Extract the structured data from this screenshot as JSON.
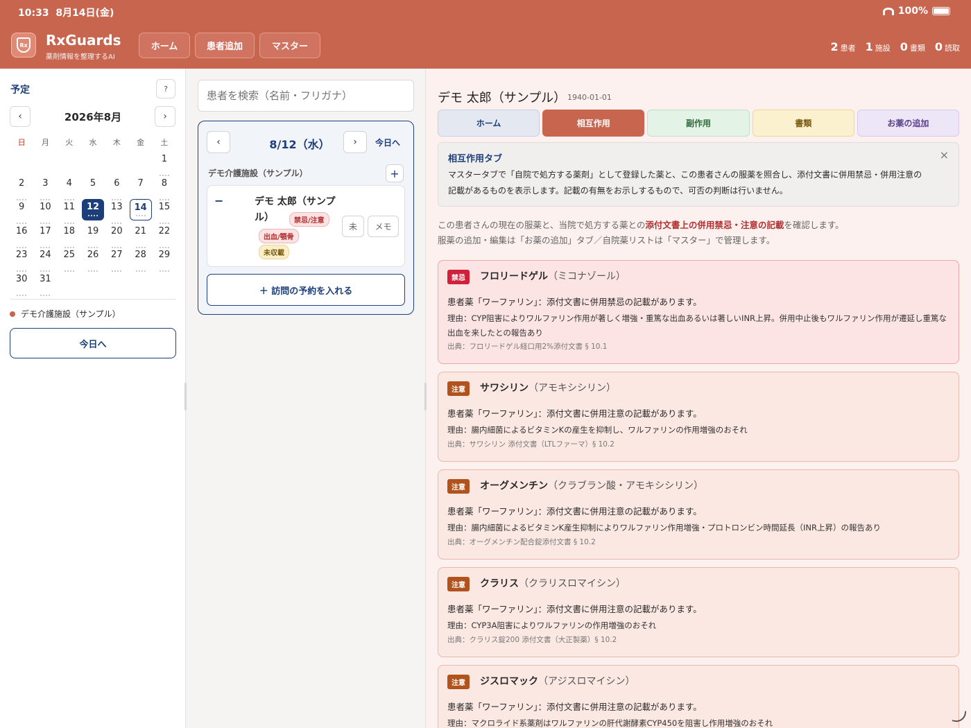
{
  "status": {
    "time": "10:33",
    "date": "8月14日(金)",
    "battery": "100%"
  },
  "header": {
    "logo_text": "Rx",
    "brand": "RxGuards",
    "tagline": "薬剤情報を整理するAI",
    "nav": [
      "ホーム",
      "患者追加",
      "マスター"
    ],
    "stats": [
      {
        "num": "2",
        "label": "患者"
      },
      {
        "num": "1",
        "label": "施設"
      },
      {
        "num": "0",
        "label": "書類"
      },
      {
        "num": "0",
        "label": "読取"
      }
    ]
  },
  "calendar": {
    "title": "予定",
    "help": "?",
    "prev": "‹",
    "next": "›",
    "month": "2026年8月",
    "dow": [
      "日",
      "月",
      "火",
      "水",
      "木",
      "金",
      "土"
    ],
    "days": [
      "",
      "",
      "",
      "",
      "",
      "",
      "1",
      "2",
      "3",
      "4",
      "5",
      "6",
      "7",
      "8",
      "9",
      "10",
      "11",
      "12",
      "13",
      "14",
      "15",
      "16",
      "17",
      "18",
      "19",
      "20",
      "21",
      "22",
      "23",
      "24",
      "25",
      "26",
      "27",
      "28",
      "29",
      "30",
      "31"
    ],
    "selected": "12",
    "today": "14",
    "facility": "デモ介護施設（サンプル）",
    "today_button": "今日へ"
  },
  "middle": {
    "search_placeholder": "患者を検索（名前・フリガナ）",
    "prev": "‹",
    "next": "›",
    "day_label": "8/12（水）",
    "today_link": "今日へ",
    "facility": "デモ介護施設（サンプル）",
    "plus": "+",
    "collapse": "−",
    "patient_name": "デモ 太郎（サンプル）",
    "tags": [
      "禁忌/注意",
      "出血/顎骨",
      "未収載"
    ],
    "btn_mi": "未",
    "btn_memo": "メモ",
    "visit_button": "＋ 訪問の予約を入れる"
  },
  "patient": {
    "name": "デモ 太郎（サンプル）",
    "birth": "1940-01-01",
    "tabs": [
      {
        "label": "ホーム",
        "bg": "#e3e8f1",
        "fg": "#1c3e7a",
        "border": "#c6d0e0"
      },
      {
        "label": "相互作用",
        "bg": "#c8654e",
        "fg": "#ffffff",
        "border": "#c8654e"
      },
      {
        "label": "副作用",
        "bg": "#e3f3e6",
        "fg": "#2e6b3a",
        "border": "#c3e0c9"
      },
      {
        "label": "書類",
        "bg": "#fbf1cf",
        "fg": "#7a5a10",
        "border": "#ecd99a"
      },
      {
        "label": "お薬の追加",
        "bg": "#ece6f6",
        "fg": "#5a3f8c",
        "border": "#d6cbe9"
      }
    ],
    "info_title": "相互作用タブ",
    "info_text": "マスタータブで「自院で処方する薬剤」として登録した薬と、この患者さんの服薬を照合し、添付文書に併用禁忌・併用注意の記載があるものを表示します。記載の有無をお示しするもので、可否の判断は行いません。",
    "info_close": "×",
    "intro_a": "この患者さんの現在の服薬と、当院で処方する薬との",
    "intro_hl": "添付文書上の併用禁忌・注意の記載",
    "intro_b": "を確認します。",
    "intro_line2": "服薬の追加・編集は「お薬の追加」タブ／自院薬リストは「マスター」で管理します。"
  },
  "interactions": [
    {
      "level": "禁忌",
      "kind": "danger",
      "drug": "フロリードゲル",
      "generic": "（ミコナゾール）",
      "patient_drug": "患者薬「ワーファリン」：添付文書に併用禁忌の記載があります。",
      "reason": "理由：CYP阻害によりワルファリン作用が著しく増強・重篤な出血あるいは著しいINR上昇。併用中止後もワルファリン作用が遷延し重篤な出血を来したとの報告あり",
      "source": "出典：フロリードゲル経口用2%添付文書 § 10.1"
    },
    {
      "level": "注意",
      "kind": "caution",
      "drug": "サワシリン",
      "generic": "（アモキシシリン）",
      "patient_drug": "患者薬「ワーファリン」：添付文書に併用注意の記載があります。",
      "reason": "理由：腸内細菌によるビタミンKの産生を抑制し、ワルファリンの作用増強のおそれ",
      "source": "出典：サワシリン 添付文書（LTLファーマ）§ 10.2"
    },
    {
      "level": "注意",
      "kind": "caution",
      "drug": "オーグメンチン",
      "generic": "（クラブラン酸・アモキシシリン）",
      "patient_drug": "患者薬「ワーファリン」：添付文書に併用注意の記載があります。",
      "reason": "理由：腸内細菌によるビタミンK産生抑制によりワルファリン作用増強・プロトロンビン時間延長（INR上昇）の報告あり",
      "source": "出典：オーグメンチン配合錠添付文書 § 10.2"
    },
    {
      "level": "注意",
      "kind": "caution",
      "drug": "クラリス",
      "generic": "（クラリスロマイシン）",
      "patient_drug": "患者薬「ワーファリン」：添付文書に併用注意の記載があります。",
      "reason": "理由：CYP3A阻害によりワルファリンの作用増強のおそれ",
      "source": "出典：クラリス錠200 添付文書（大正製薬）§ 10.2"
    },
    {
      "level": "注意",
      "kind": "caution",
      "drug": "ジスロマック",
      "generic": "（アジスロマイシン）",
      "patient_drug": "患者薬「ワーファリン」：添付文書に併用注意の記載があります。",
      "reason": "理由：マクロライド系薬剤はワルファリンの肝代謝酵素CYP450を阻害し作用増強のおそれ",
      "source": ""
    }
  ]
}
